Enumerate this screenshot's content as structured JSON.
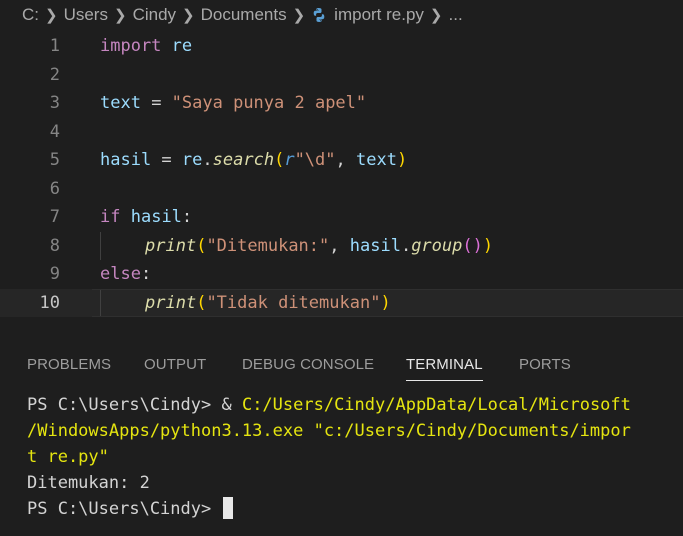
{
  "breadcrumb": {
    "items": [
      "C:",
      "Users",
      "Cindy",
      "Documents",
      "import re.py",
      "..."
    ]
  },
  "editor": {
    "current_line": 10,
    "line_numbers": [
      "1",
      "2",
      "3",
      "4",
      "5",
      "6",
      "7",
      "8",
      "9",
      "10"
    ],
    "tokens": {
      "import": "import",
      "re": "re",
      "text": "text",
      "eq": " = ",
      "text_str": "\"Saya punya 2 apel\"",
      "hasil": "hasil",
      "re2": "re",
      "dot": ".",
      "search": "search",
      "lp": "(",
      "rp": ")",
      "r": "r",
      "pattern": "\"\\d\"",
      "comma": ", ",
      "text_arg": "text",
      "if": "if",
      "sp": " ",
      "hasil_cond": "hasil",
      "colon": ":",
      "print1": "print",
      "found_str": "\"Ditemukan:\"",
      "hasil_arg": "hasil",
      "group": "group",
      "group_parens": "()",
      "else": "else",
      "print2": "print",
      "notfound_str": "\"Tidak ditemukan\""
    }
  },
  "panel": {
    "tabs": [
      "PROBLEMS",
      "OUTPUT",
      "DEBUG CONSOLE",
      "TERMINAL",
      "PORTS"
    ],
    "active_tab": "TERMINAL"
  },
  "terminal": {
    "prompt": "PS C:\\Users\\Cindy> ",
    "amp": "& ",
    "exe_line1": "C:/Users/Cindy/AppData/Local/Microsoft",
    "exe_line2": "/WindowsApps/python3.13.exe",
    "arg_line2": " \"c:/Users/Cindy/Documents/impor",
    "arg_line3": "t re.py\"",
    "output": "Ditemukan: 2",
    "prompt2": "PS C:\\Users\\Cindy> "
  },
  "colors": {
    "background": "#1e1e1e",
    "keyword": "#c586c0",
    "variable": "#9cdcfe",
    "string": "#ce9178",
    "function": "#dcdcaa",
    "terminal_path": "#e5e510"
  }
}
